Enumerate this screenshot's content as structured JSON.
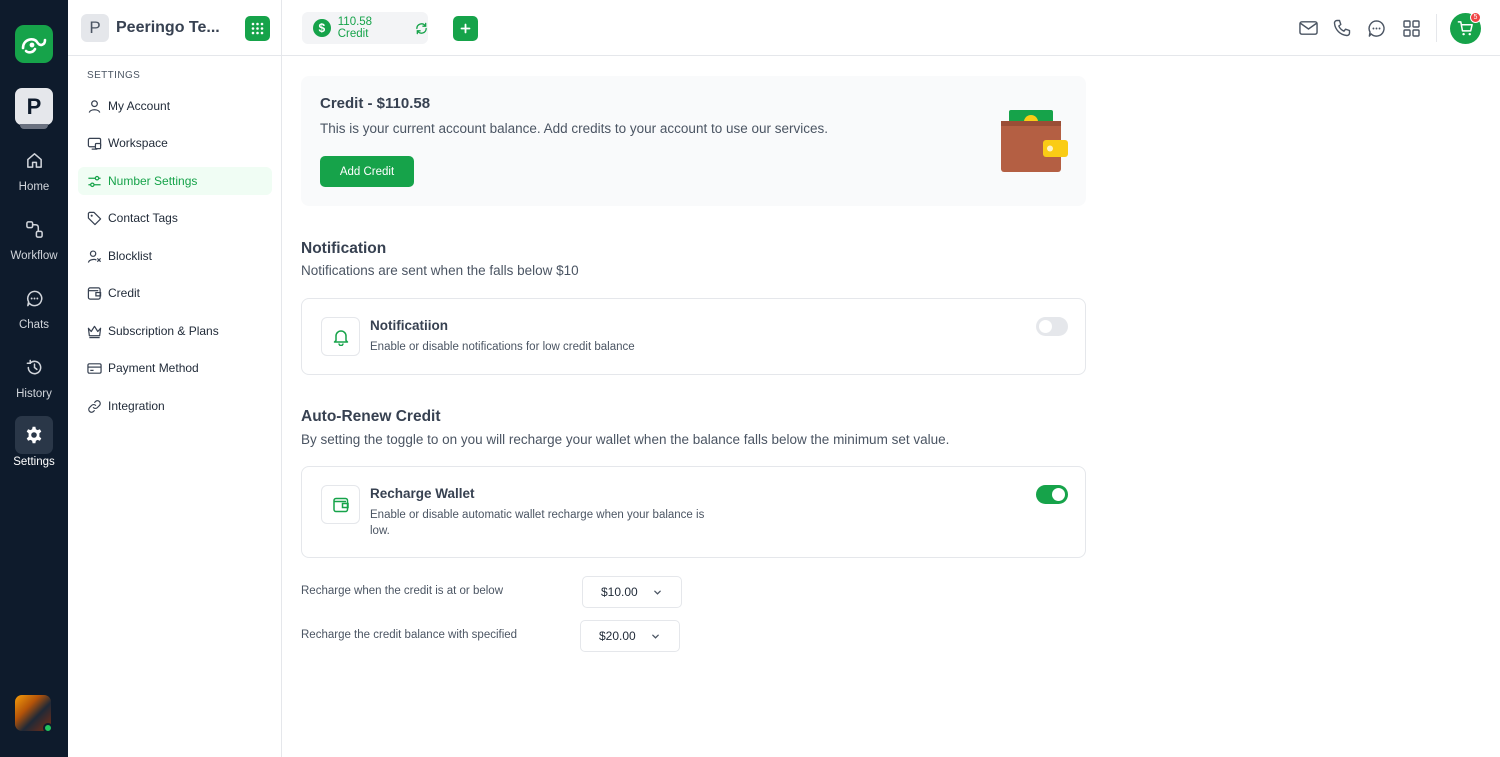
{
  "rail": {
    "workspace_initial": "P",
    "items": [
      {
        "label": "Home",
        "icon": "home-icon"
      },
      {
        "label": "Workflow",
        "icon": "workflow-icon"
      },
      {
        "label": "Chats",
        "icon": "chat-icon"
      },
      {
        "label": "History",
        "icon": "history-icon"
      },
      {
        "label": "Settings",
        "icon": "gear-icon",
        "active": true
      }
    ]
  },
  "sidebar": {
    "workspace_initial": "P",
    "workspace_name": "Peeringo Te...",
    "section_label": "SETTINGS",
    "items": [
      {
        "label": "My Account",
        "icon": "user-icon"
      },
      {
        "label": "Workspace",
        "icon": "workspace-icon"
      },
      {
        "label": "Number Settings",
        "icon": "number-settings-icon",
        "active": true
      },
      {
        "label": "Contact Tags",
        "icon": "tag-icon"
      },
      {
        "label": "Blocklist",
        "icon": "block-user-icon"
      },
      {
        "label": "Credit",
        "icon": "credit-icon"
      },
      {
        "label": "Subscription & Plans",
        "icon": "crown-icon"
      },
      {
        "label": "Payment Method",
        "icon": "card-icon"
      },
      {
        "label": "Integration",
        "icon": "link-icon"
      }
    ]
  },
  "topbar": {
    "credit_label": "110.58 Credit",
    "currency_symbol": "$",
    "cart_badge": "5"
  },
  "credit_card": {
    "title": "Credit - $110.58",
    "description": "This is your current account balance. Add credits to your account to use our services.",
    "add_button": "Add Credit"
  },
  "notification": {
    "title": "Notification",
    "description": "Notifications are sent when the falls below $10",
    "card_title": "Notificatiion",
    "card_sub": "Enable or disable notifications for low credit balance",
    "enabled": false
  },
  "auto_renew": {
    "title": "Auto-Renew Credit",
    "description": "By setting the toggle to on you will recharge your wallet when the balance falls below the minimum set value.",
    "card_title": "Recharge Wallet",
    "card_sub": "Enable or disable automatic wallet recharge when your balance is low.",
    "enabled": true,
    "threshold_label": "Recharge when the credit is at or below",
    "threshold_value": "$10.00",
    "amount_label": "Recharge the credit balance with specified",
    "amount_value": "$20.00"
  },
  "colors": {
    "accent": "#16a34a",
    "rail_bg": "#0e1b2c",
    "badge": "#ef4444"
  }
}
